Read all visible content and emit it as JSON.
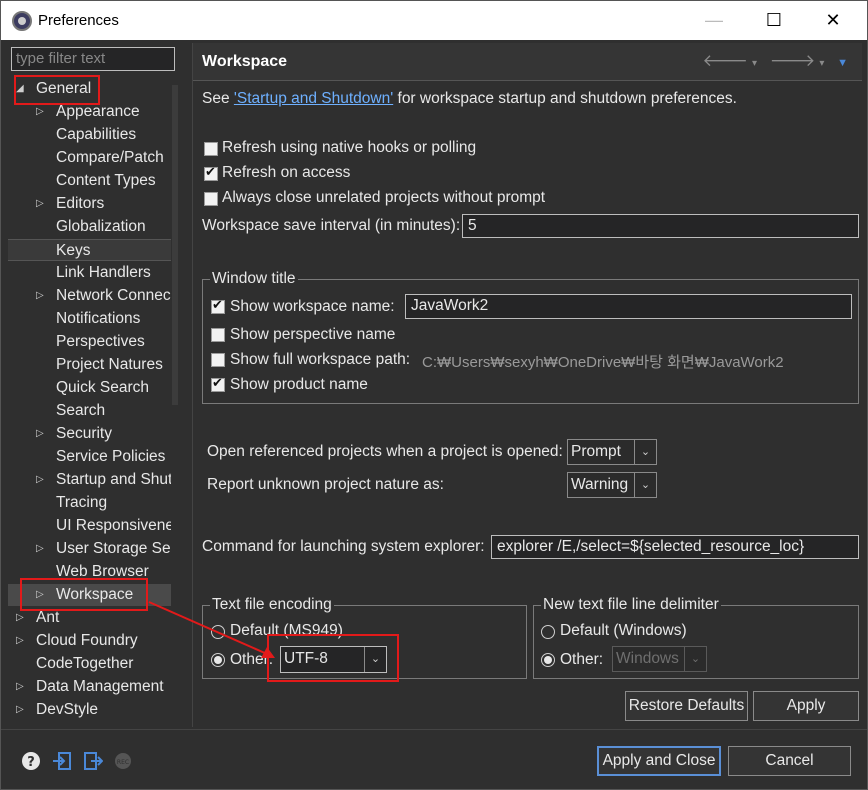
{
  "window": {
    "title": "Preferences",
    "minimize": "—",
    "maximize": "☐",
    "close": "✕"
  },
  "filter": {
    "placeholder": "type filter text"
  },
  "tree": [
    {
      "label": "General",
      "level": 0,
      "twisty": "expanded"
    },
    {
      "label": "Appearance",
      "level": 1,
      "twisty": "collapsed"
    },
    {
      "label": "Capabilities",
      "level": 1,
      "twisty": ""
    },
    {
      "label": "Compare/Patch",
      "level": 1,
      "twisty": ""
    },
    {
      "label": "Content Types",
      "level": 1,
      "twisty": ""
    },
    {
      "label": "Editors",
      "level": 1,
      "twisty": "collapsed"
    },
    {
      "label": "Globalization",
      "level": 1,
      "twisty": ""
    },
    {
      "label": "Keys",
      "level": 1,
      "twisty": ""
    },
    {
      "label": "Link Handlers",
      "level": 1,
      "twisty": ""
    },
    {
      "label": "Network Connec",
      "level": 1,
      "twisty": "collapsed"
    },
    {
      "label": "Notifications",
      "level": 1,
      "twisty": ""
    },
    {
      "label": "Perspectives",
      "level": 1,
      "twisty": ""
    },
    {
      "label": "Project Natures",
      "level": 1,
      "twisty": ""
    },
    {
      "label": "Quick Search",
      "level": 1,
      "twisty": ""
    },
    {
      "label": "Search",
      "level": 1,
      "twisty": ""
    },
    {
      "label": "Security",
      "level": 1,
      "twisty": "collapsed"
    },
    {
      "label": "Service Policies",
      "level": 1,
      "twisty": ""
    },
    {
      "label": "Startup and Shut",
      "level": 1,
      "twisty": "collapsed"
    },
    {
      "label": "Tracing",
      "level": 1,
      "twisty": ""
    },
    {
      "label": "UI Responsivene",
      "level": 1,
      "twisty": ""
    },
    {
      "label": "User Storage Ser",
      "level": 1,
      "twisty": "collapsed"
    },
    {
      "label": "Web Browser",
      "level": 1,
      "twisty": ""
    },
    {
      "label": "Workspace",
      "level": 1,
      "twisty": "collapsed"
    },
    {
      "label": "Ant",
      "level": 0,
      "twisty": "collapsed"
    },
    {
      "label": "Cloud Foundry",
      "level": 0,
      "twisty": "collapsed"
    },
    {
      "label": "CodeTogether",
      "level": 0,
      "twisty": ""
    },
    {
      "label": "Data Management",
      "level": 0,
      "twisty": "collapsed"
    },
    {
      "label": "DevStyle",
      "level": 0,
      "twisty": "collapsed"
    }
  ],
  "page": {
    "title": "Workspace",
    "see_prefix": "See ",
    "see_link": "'Startup and Shutdown'",
    "see_suffix": " for workspace startup and shutdown preferences.",
    "refresh_native": "Refresh using native hooks or polling",
    "refresh_access": "Refresh on access",
    "always_close": "Always close unrelated projects without prompt",
    "save_interval_label": "Workspace save interval (in minutes):",
    "save_interval_value": "5",
    "window_title_group": "Window title",
    "show_ws_name": "Show workspace name:",
    "ws_name_value": "JavaWork2",
    "show_perspective": "Show perspective name",
    "show_full_path": "Show full workspace path:",
    "full_path_value": "C:₩Users₩sexyh₩OneDrive₩바탕 화면₩JavaWork2",
    "show_product": "Show product name",
    "open_referenced_label": "Open referenced projects when a project is opened:",
    "open_referenced_value": "Prompt",
    "report_unknown_label": "Report unknown project nature as:",
    "report_unknown_value": "Warning",
    "command_label": "Command for launching system explorer:",
    "command_value": "explorer /E,/select=${selected_resource_loc}",
    "encoding_group": "Text file encoding",
    "encoding_default": "Default (MS949)",
    "encoding_other": "Other:",
    "encoding_value": "UTF-8",
    "delimiter_group": "New text file line delimiter",
    "delimiter_default": "Default (Windows)",
    "delimiter_other": "Other:",
    "delimiter_value": "Windows",
    "restore_defaults": "Restore Defaults",
    "apply": "Apply"
  },
  "footer": {
    "apply_close": "Apply and Close",
    "cancel": "Cancel"
  },
  "colors": {
    "highlight": "#e21a1a",
    "accent": "#4a88d8"
  }
}
